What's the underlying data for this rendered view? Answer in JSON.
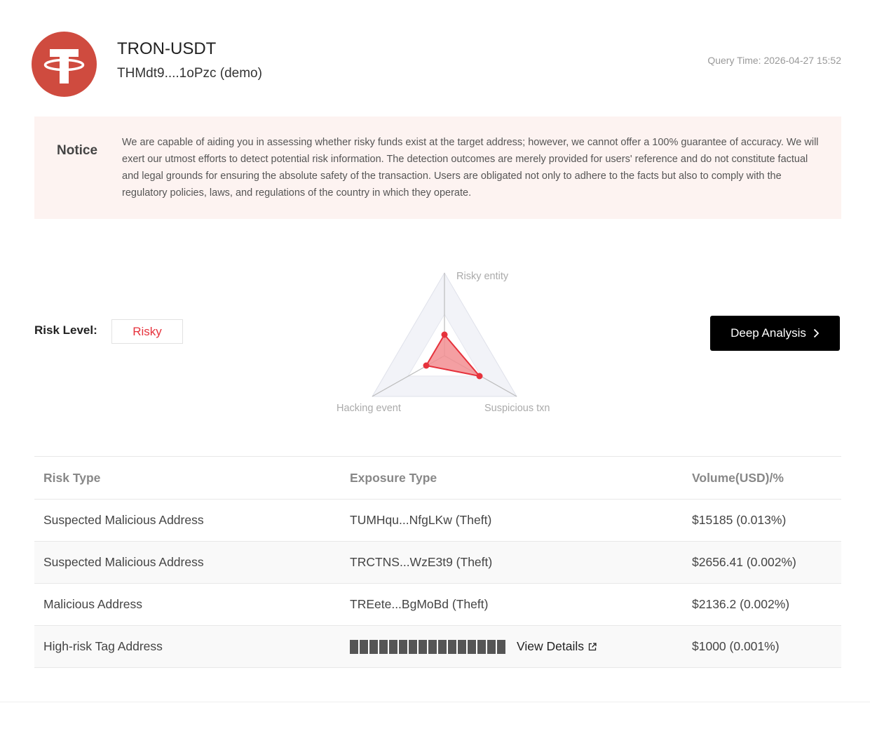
{
  "token": {
    "name": "TRON-USDT",
    "address": "THMdt9....1oPzc (demo)",
    "logo_icon": "tether-logo-icon",
    "logo_color": "#cf4b3f"
  },
  "query_time": "Query Time: 2026-04-27 15:52",
  "notice": {
    "title": "Notice",
    "text": "We are capable of aiding you in assessing whether risky funds exist at the target address; however, we cannot offer a 100% guarantee of accuracy. We will exert our utmost efforts to detect potential risk information. The detection outcomes are merely provided for users' reference and do not constitute factual and legal grounds for ensuring the absolute safety of the transaction. Users are obligated not only to adhere to the facts but also to comply with the regulatory policies, laws, and regulations of the country in which they operate."
  },
  "risk": {
    "label": "Risk Level:",
    "level": "Risky",
    "level_color": "#e6323c"
  },
  "radar": {
    "axes": [
      "Risky entity",
      "Suspicious txn",
      "Hacking event"
    ],
    "values": [
      0.3,
      0.5,
      0.25
    ],
    "fill_color": "#e6323c"
  },
  "deep_analysis": {
    "label": "Deep Analysis",
    "icon": "chevron-right-icon"
  },
  "table": {
    "headers": [
      "Risk Type",
      "Exposure Type",
      "Volume(USD)/%"
    ],
    "rows": [
      {
        "risk_type": "Suspected Malicious Address",
        "exposure": "TUMHqu...NfgLKw (Theft)",
        "volume": "$15185 (0.013%)"
      },
      {
        "risk_type": "Suspected Malicious Address",
        "exposure": "TRCTNS...WzE3t9 (Theft)",
        "volume": "$2656.41 (0.002%)"
      },
      {
        "risk_type": "Malicious Address",
        "exposure": "TREete...BgMoBd (Theft)",
        "volume": "$2136.2 (0.002%)"
      },
      {
        "risk_type": "High-risk Tag Address",
        "exposure_masked": true,
        "link": "View Details",
        "volume": "$1000 (0.001%)"
      }
    ]
  }
}
